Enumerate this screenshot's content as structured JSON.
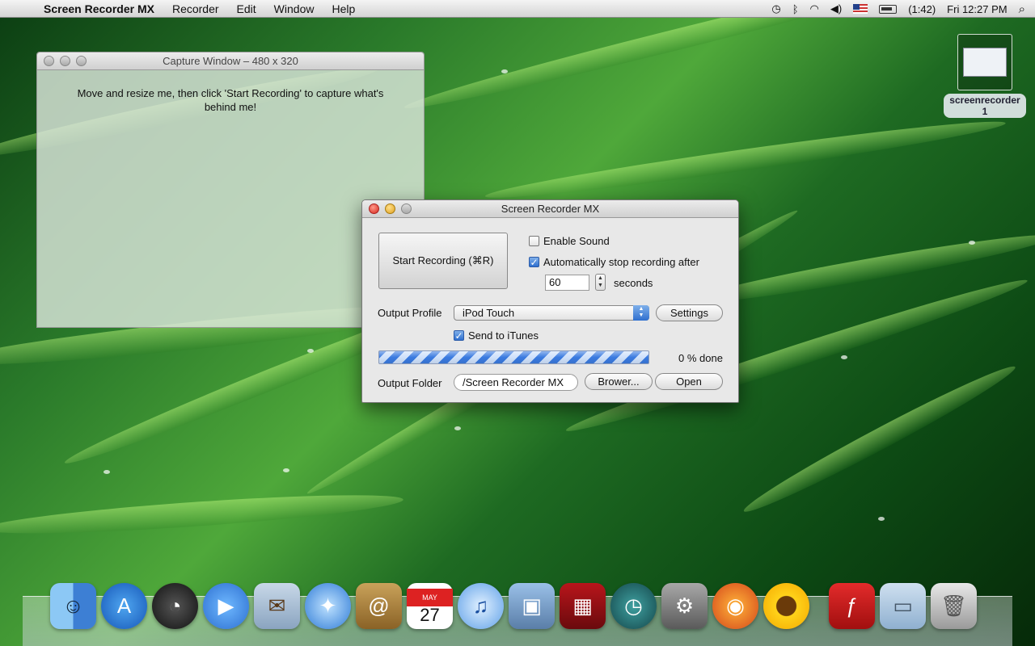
{
  "menubar": {
    "app_name": "Screen Recorder MX",
    "items": [
      "Recorder",
      "Edit",
      "Window",
      "Help"
    ],
    "battery_time": "(1:42)",
    "clock": "Fri 12:27 PM"
  },
  "capture_window": {
    "title": "Capture Window – 480 x 320",
    "message": "Move and resize me, then click 'Start Recording' to capture what's behind me!"
  },
  "desktop_icon": {
    "label_line1": "screenrecorder",
    "label_line2": "1"
  },
  "main_window": {
    "title": "Screen Recorder MX",
    "start_button": "Start Recording (⌘R)",
    "enable_sound": {
      "label": "Enable Sound",
      "checked": false
    },
    "auto_stop": {
      "label": "Automatically stop recording after",
      "checked": true
    },
    "seconds_value": "60",
    "seconds_label": "seconds",
    "output_profile_label": "Output Profile",
    "output_profile_value": "iPod Touch",
    "settings_button": "Settings",
    "send_itunes": {
      "label": "Send to iTunes",
      "checked": true
    },
    "progress_percent": 0,
    "progress_text": "0 % done",
    "output_folder_label": "Output Folder",
    "output_folder_value": "/Screen Recorder MX",
    "browse_button": "Brower...",
    "open_button": "Open"
  },
  "dock": {
    "icons": [
      "finder-icon",
      "app-store-icon",
      "dashboard-icon",
      "facetime-icon",
      "mail-icon",
      "safari-icon",
      "address-book-icon",
      "ical-icon",
      "itunes-icon",
      "iphoto-icon",
      "photo-booth-icon",
      "time-machine-icon",
      "system-preferences-icon",
      "firefox-icon",
      "sunflower-icon",
      "flash-icon",
      "documents-folder-icon",
      "trash-icon"
    ],
    "ical_month": "MAY",
    "ical_day": "27"
  },
  "colors": {
    "accent_blue": "#2f6fcf",
    "close_red": "#d6261b",
    "minimize_yellow": "#e0a020"
  }
}
